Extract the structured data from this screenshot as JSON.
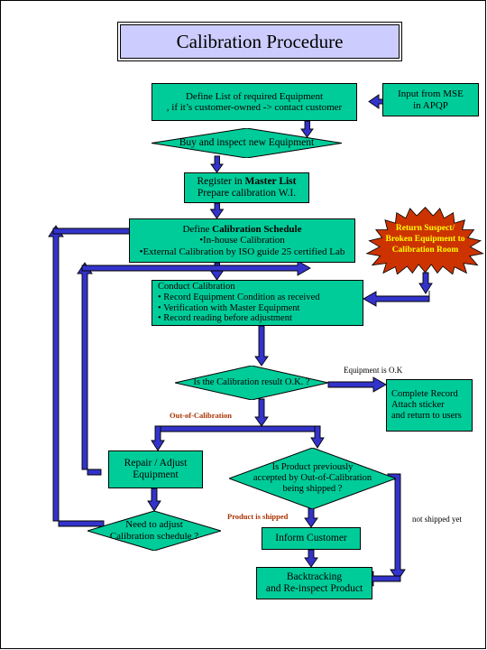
{
  "document": {
    "title": "Calibration Procedure",
    "colors": {
      "process_fill": "#00CC99",
      "title_fill": "#CCCCFF",
      "arrow": "#3333CC",
      "burst_fill": "#CC3300",
      "burst_text": "#FFFF00",
      "label_red": "#AA3300",
      "outline": "#000000"
    }
  },
  "nodes": {
    "title": {
      "label": "Calibration Procedure"
    },
    "define_list": {
      "lines": [
        "Define List of required Equipment",
        ", if it’s customer-owned -> contact customer"
      ]
    },
    "input_mse": {
      "lines": [
        "Input from MSE",
        "in APQP"
      ]
    },
    "buy_inspect": {
      "lines": [
        "Buy and inspect new Equipment"
      ]
    },
    "register": {
      "lines": [
        "Register in ",
        "Master List",
        "Prepare calibration W.I."
      ]
    },
    "define_schedule": {
      "lines": [
        "Define ",
        "Calibration Schedule",
        "•In-house Calibration",
        "•External Calibration by ISO guide 25 certified Lab"
      ]
    },
    "return_suspect": {
      "lines": [
        "Return Suspect/",
        "Broken Equipment to",
        "Calibration Room"
      ]
    },
    "conduct": {
      "lines": [
        "Conduct Calibration",
        "• Record Equipment Condition as received",
        "• Verification with Master Equipment",
        "• Record reading before adjustment"
      ]
    },
    "decision_calib_ok": {
      "lines": [
        "Is the Calibration result O.K. ?"
      ]
    },
    "complete_record": {
      "lines": [
        "Complete Record",
        "Attach sticker",
        "and return to users"
      ]
    },
    "repair_adjust": {
      "lines": [
        "Repair / Adjust",
        "Equipment"
      ]
    },
    "need_adjust": {
      "lines": [
        "Need to adjust",
        "Calibration schedule ?"
      ]
    },
    "product_shipped": {
      "lines": [
        "Is Product previously",
        "accepted by Out-of-Calibration",
        "being shipped ?"
      ]
    },
    "inform_customer": {
      "lines": [
        "Inform Customer"
      ]
    },
    "backtracking": {
      "lines": [
        "Backtracking",
        "and Re-inspect Product"
      ]
    }
  },
  "edge_labels": {
    "equipment_ok": "Equipment is O.K",
    "out_of_calibration": "Out-of-Calibration",
    "product_is_shipped": "Product is shipped",
    "not_shipped_yet": "not shipped yet"
  }
}
